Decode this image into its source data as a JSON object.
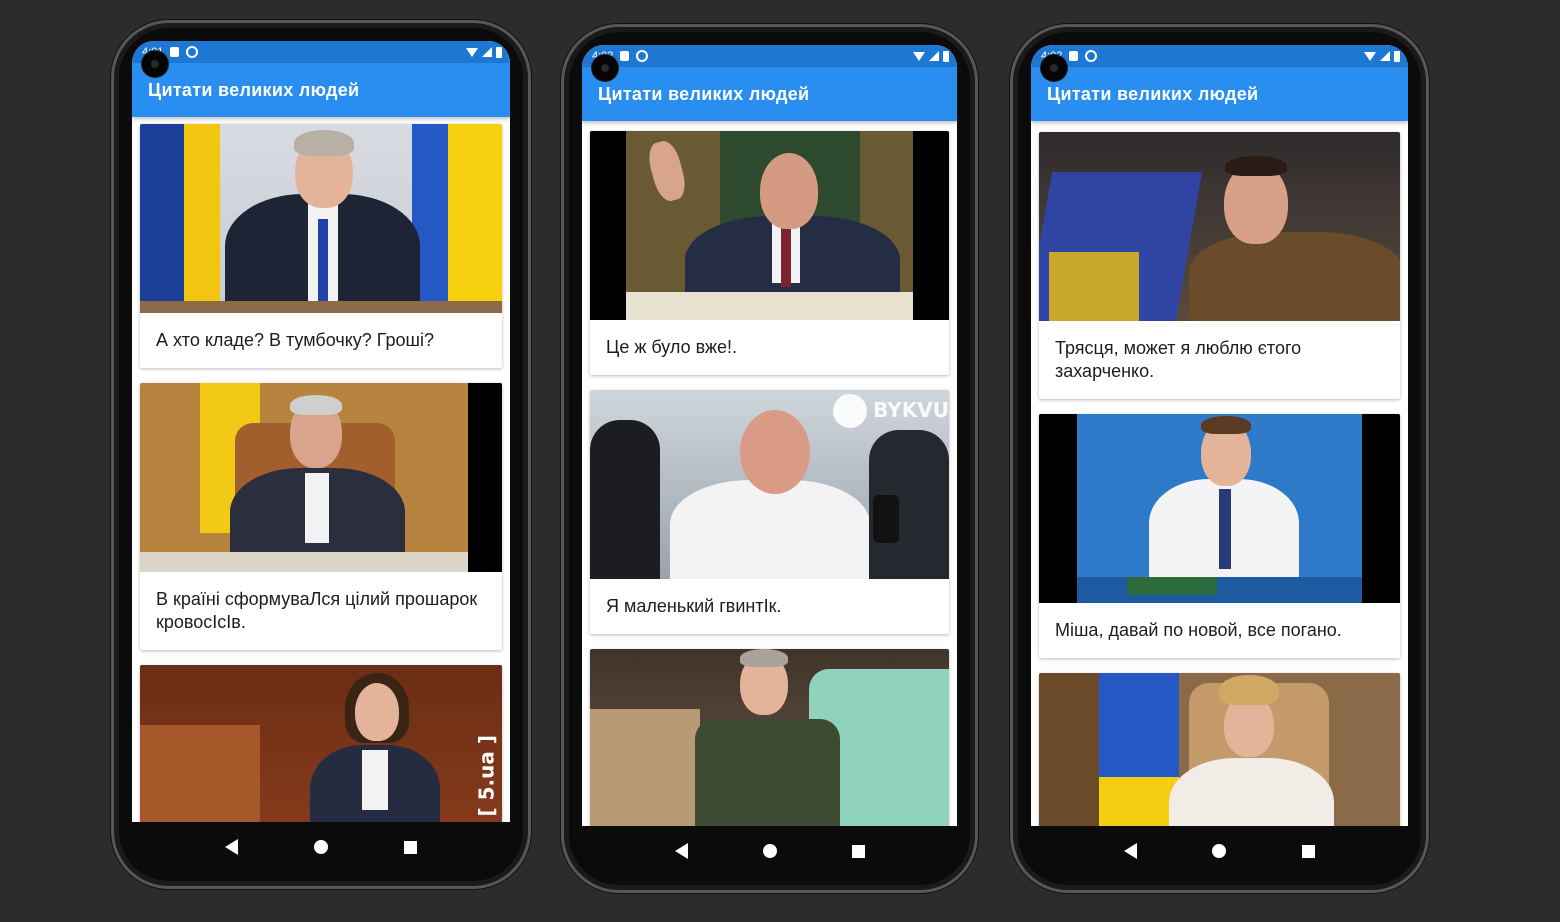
{
  "app_title": "Цитати великих людей",
  "phones": [
    {
      "status_time": "4:01",
      "cards": [
        {
          "quote": "А хто кладе? В тумбочку? Гроші?"
        },
        {
          "quote": "В країні сформуваЛся цілий прошарок кровосІсІв."
        },
        {
          "quote": "",
          "watermark": "[ 5.ua ]"
        }
      ]
    },
    {
      "status_time": "4:02",
      "cards": [
        {
          "quote": "Це ж було вже!."
        },
        {
          "quote": "Я маленький гвинтІк.",
          "watermark": "BYKVU"
        },
        {
          "quote": ""
        }
      ]
    },
    {
      "status_time": "4:02",
      "cards": [
        {
          "quote": "Трясця, может я люблю єтого захарченко."
        },
        {
          "quote": "Міша, давай по новой, все погано."
        },
        {
          "quote": ""
        }
      ]
    }
  ]
}
